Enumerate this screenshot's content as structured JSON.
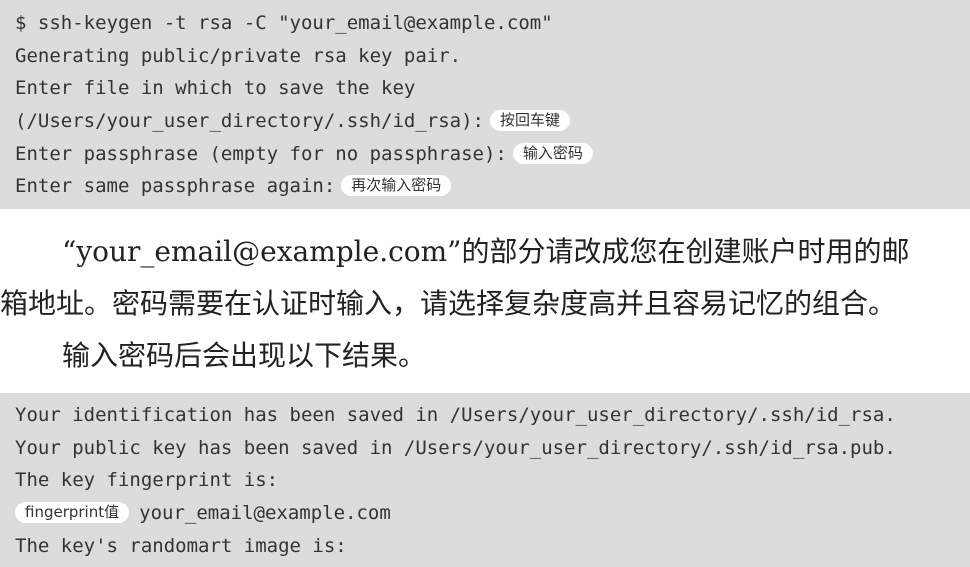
{
  "code_block_1": {
    "line1": "$ ssh-keygen -t rsa -C \"your_email@example.com\"",
    "line2": "Generating public/private rsa key pair.",
    "line3": "Enter file in which to save the key",
    "line4": "(/Users/your_user_directory/.ssh/id_rsa):",
    "line4_badge": "按回车键",
    "line5": "Enter passphrase (empty for no passphrase):",
    "line5_badge": "输入密码",
    "line6": "Enter same passphrase again:",
    "line6_badge": "再次输入密码"
  },
  "prose": {
    "line1": "“your_email@example.com”的部分请改成您在创建账户时用的邮",
    "line2": "箱地址。密码需要在认证时输入，请选择复杂度高并且容易记忆的组合。",
    "line3": "输入密码后会出现以下结果。"
  },
  "code_block_2": {
    "line1": "Your identification has been saved in /Users/your_user_directory/.ssh/id_rsa.",
    "line2": "Your public key has been saved in /Users/your_user_directory/.ssh/id_rsa.pub.",
    "line3": "The key fingerprint is:",
    "line4_badge": "fingerprint值",
    "line4": "your_email@example.com",
    "line5": "The key's randomart image is:"
  }
}
